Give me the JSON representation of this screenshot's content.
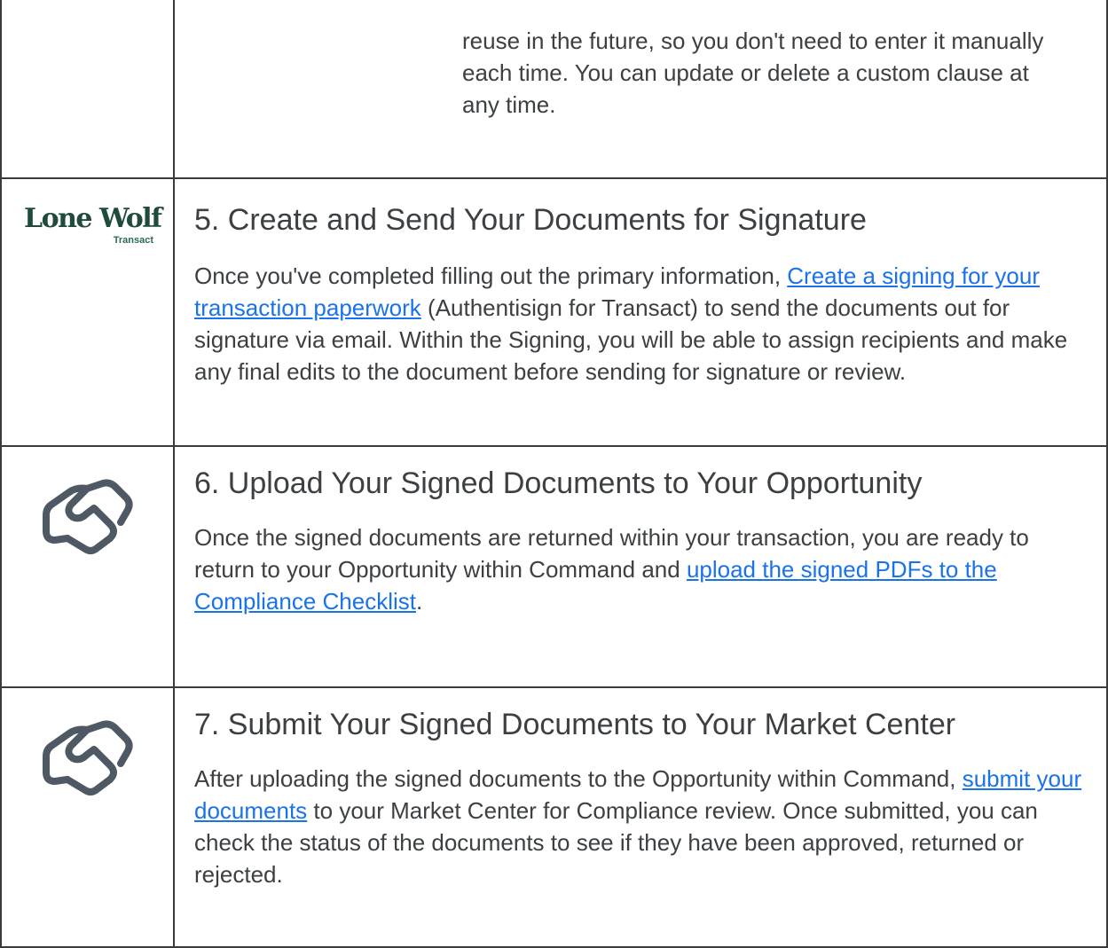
{
  "rows": [
    {
      "text": "reuse in the future, so you don't need to enter it manually each time. You can update or delete a custom clause at any time."
    },
    {
      "icon": "lone-wolf-transact-logo",
      "logo_main": "Lone Wolf",
      "logo_sub": "Transact",
      "heading": "5. Create and Send Your Documents for Signature",
      "p_before": "Once you've completed filling out the primary information, ",
      "link": "Create a signing for your transaction paperwork",
      "p_after": " (Authentisign for Transact) to send the documents out for signature via email. Within the Signing, you will be able to assign recipients and make any final edits to the document before sending for signature or review."
    },
    {
      "icon": "handshake-icon",
      "heading": "6. Upload Your Signed Documents to Your Opportunity",
      "p_before": "Once the signed documents are returned within your transaction, you are ready to return to your Opportunity within Command and ",
      "link": "upload the signed PDFs to the Compliance Checklist",
      "p_after": "."
    },
    {
      "icon": "handshake-icon",
      "heading": "7. Submit Your Signed Documents to Your Market Center",
      "p_before": "After uploading the signed documents to the Opportunity within Command, ",
      "link": "submit your documents",
      "p_after": " to your Market Center for Compliance review. Once submitted,  you can check the status of the documents to see if they have been approved, returned or rejected."
    }
  ],
  "colors": {
    "link": "#1a73e8",
    "text": "#3c4043",
    "logo": "#1f4b3a",
    "border": "#3a3a3a",
    "icon": "#4f5963"
  }
}
